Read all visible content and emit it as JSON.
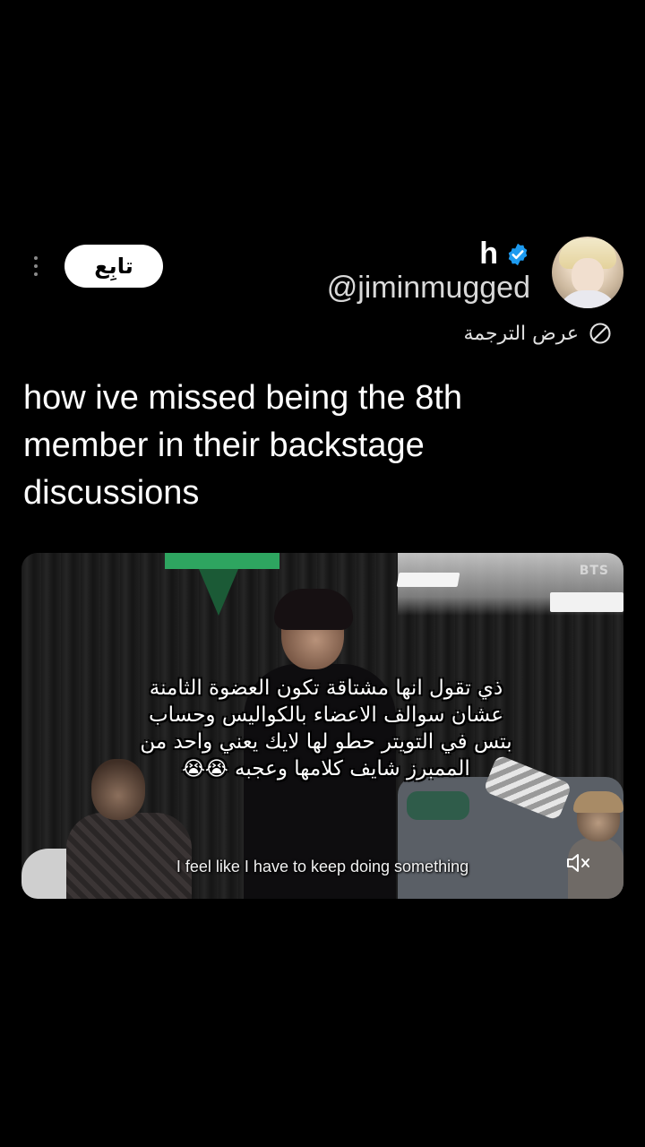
{
  "profile": {
    "display_name": "h",
    "handle": "@jiminmugged",
    "verified": true,
    "verified_color": "#1d9bf0",
    "follow_label": "تابِع",
    "more_icon": "vertical-dots-icon"
  },
  "translation": {
    "label": "عرض الترجمة",
    "icon": "globe-icon"
  },
  "tweet": {
    "text_lines": [
      "how ive missed being the 8th",
      "member in their backstage",
      "discussions"
    ]
  },
  "media": {
    "caption_ar_lines": [
      "ذي تقول انها مشتاقة تكون العضوة الثامنة",
      "عشان سوالف الاعضاء بالكواليس وحساب",
      "بتس في التويتر حطو لها لايك يعني واحد من",
      "الممبرز شايف كلامها وعجبه"
    ],
    "caption_emoji": "😭😭",
    "subtitle_en": "I feel like I have to keep doing something",
    "watermark": "BTS",
    "mute_icon": "speaker-muted-icon"
  }
}
